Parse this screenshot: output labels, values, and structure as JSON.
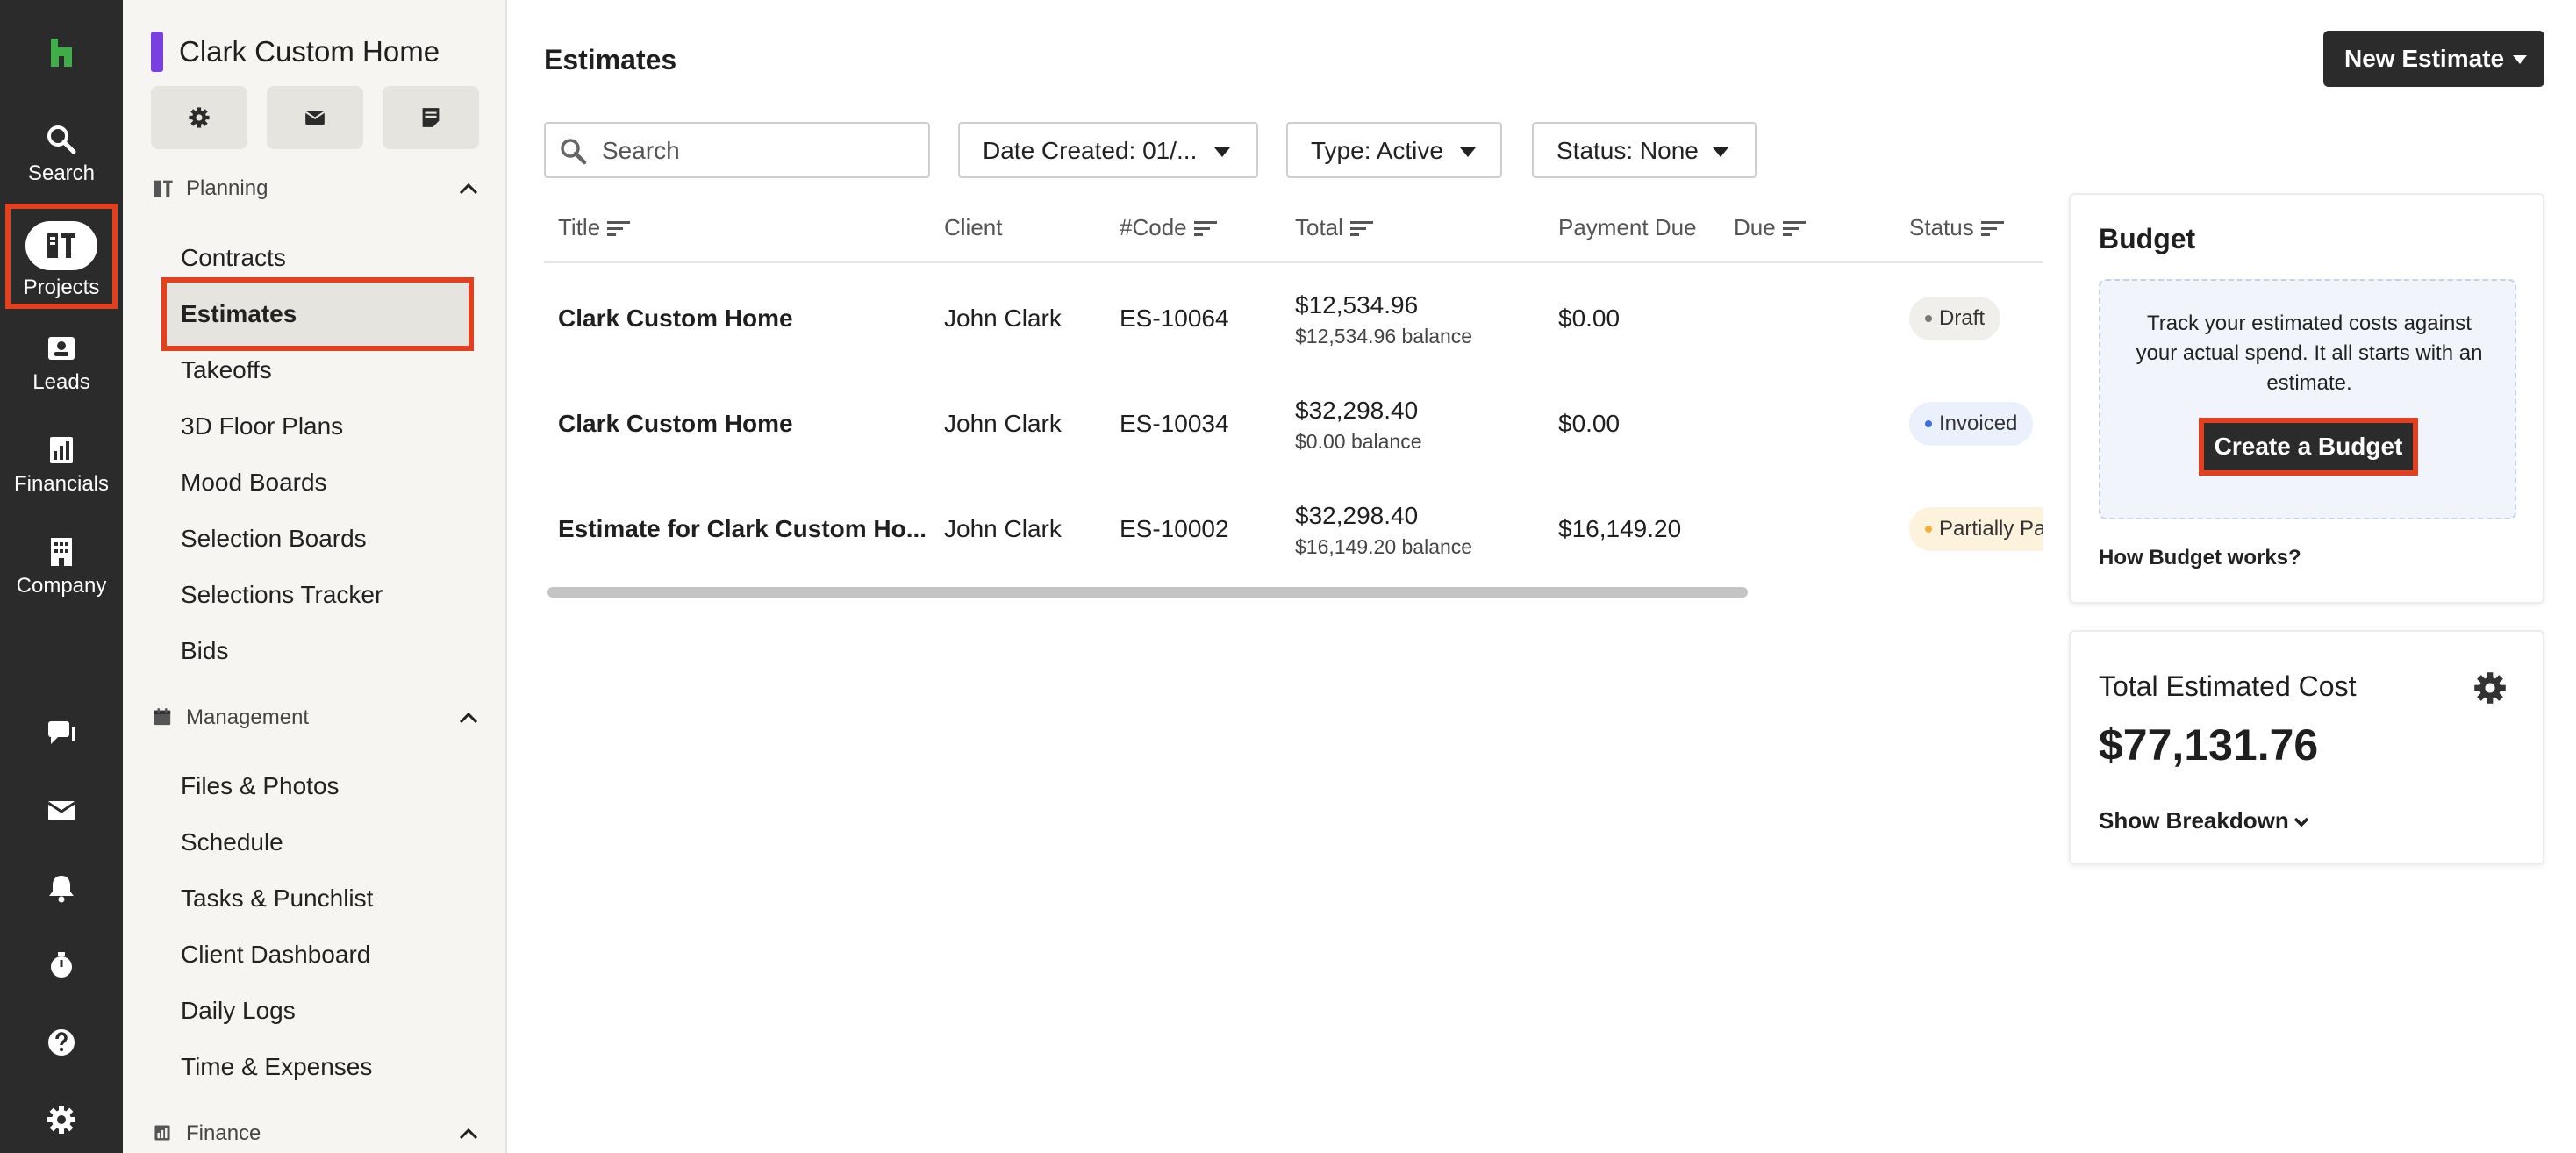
{
  "rail": {
    "items": [
      {
        "label": "Search",
        "icon": "search-icon"
      },
      {
        "label": "Projects",
        "icon": "projects-icon"
      },
      {
        "label": "Leads",
        "icon": "leads-icon"
      },
      {
        "label": "Financials",
        "icon": "financials-icon"
      },
      {
        "label": "Company",
        "icon": "company-icon"
      }
    ],
    "bottom_icons": [
      "chat-icon",
      "mail-icon",
      "bell-icon",
      "timer-icon",
      "help-icon",
      "settings-icon"
    ]
  },
  "project": {
    "title": "Clark Custom Home",
    "accent_color": "#7a3fe0",
    "quick_buttons": [
      "settings-icon",
      "mail-icon",
      "notes-icon"
    ]
  },
  "sidebar": {
    "planning": {
      "label": "Planning",
      "items": [
        "Contracts",
        "Estimates",
        "Takeoffs",
        "3D Floor Plans",
        "Mood Boards",
        "Selection Boards",
        "Selections Tracker",
        "Bids"
      ]
    },
    "management": {
      "label": "Management",
      "items": [
        "Files & Photos",
        "Schedule",
        "Tasks & Punchlist",
        "Client Dashboard",
        "Daily Logs",
        "Time & Expenses"
      ]
    },
    "finance": {
      "label": "Finance"
    }
  },
  "main": {
    "title": "Estimates",
    "new_button": "New Estimate",
    "search_placeholder": "Search",
    "filters": {
      "date": "Date Created: 01/...",
      "type": "Type: Active",
      "status": "Status: None"
    },
    "columns": {
      "title": "Title",
      "client": "Client",
      "code": "#Code",
      "total": "Total",
      "payment_due": "Payment Due",
      "due": "Due",
      "status": "Status"
    },
    "rows": [
      {
        "title": "Clark Custom Home",
        "client": "John Clark",
        "code": "ES-10064",
        "total": "$12,534.96",
        "balance": "$12,534.96 balance",
        "payment_due": "$0.00",
        "status": "Draft"
      },
      {
        "title": "Clark Custom Home",
        "client": "John Clark",
        "code": "ES-10034",
        "total": "$32,298.40",
        "balance": "$0.00 balance",
        "payment_due": "$0.00",
        "status": "Invoiced"
      },
      {
        "title": "Estimate for Clark Custom Ho...",
        "client": "John Clark",
        "code": "ES-10002",
        "total": "$32,298.40",
        "balance": "$16,149.20 balance",
        "payment_due": "$16,149.20",
        "status": "Partially Pa"
      }
    ]
  },
  "budget": {
    "title": "Budget",
    "description": "Track your estimated costs against your actual spend. It all starts with an estimate.",
    "button": "Create a Budget",
    "link": "How Budget works?"
  },
  "total_estimated": {
    "title": "Total Estimated Cost",
    "value": "$77,131.76",
    "breakdown": "Show Breakdown"
  },
  "colors": {
    "highlight": "#e2401f",
    "rail_bg": "#2b2b2b",
    "logo_green": "#3fae49",
    "status_draft_dot": "#777777",
    "status_invoiced_dot": "#3b6fe0",
    "status_partial_dot": "#f2b23a"
  }
}
